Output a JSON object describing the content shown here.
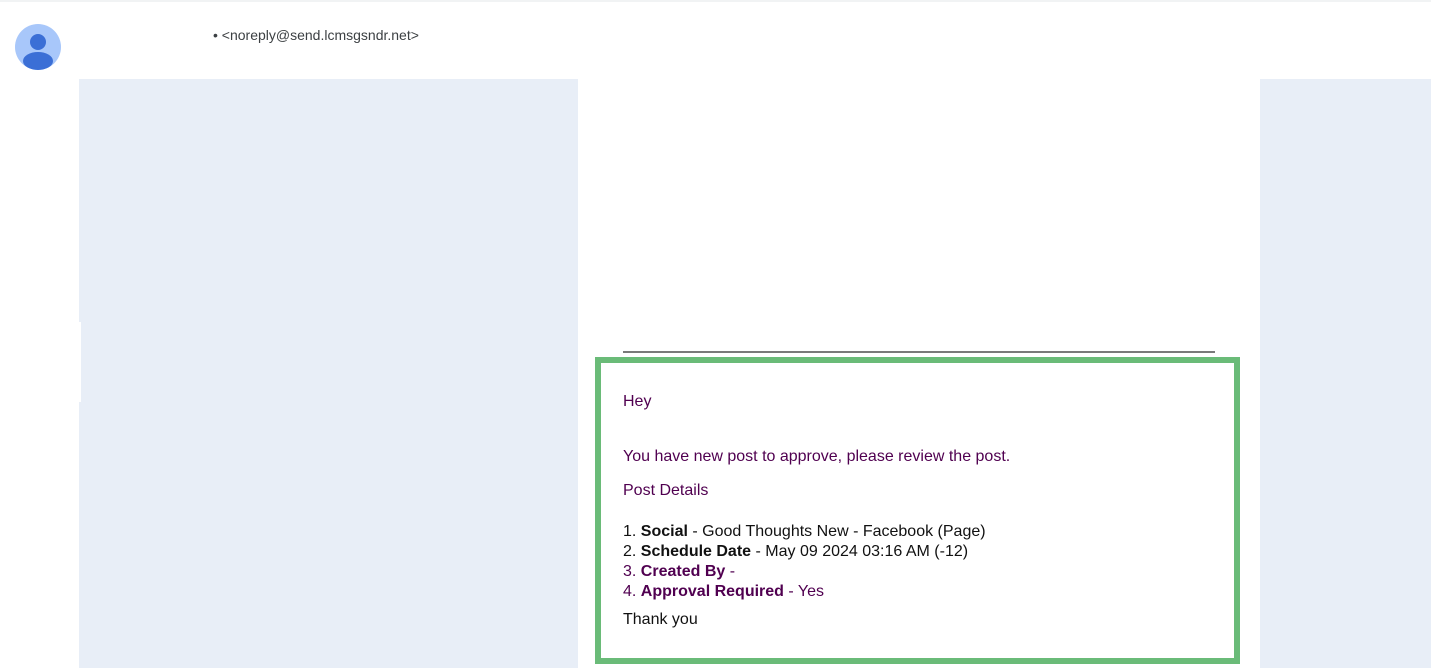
{
  "header": {
    "sender_email": "• <noreply@send.lcmsgsndr.net>"
  },
  "message": {
    "greeting": "Hey",
    "intro": "You have new post to approve, please review the post.",
    "details_heading": "Post Details",
    "details": [
      {
        "num": "1.",
        "label": "Social",
        "value": " - Good Thoughts New - Facebook (Page)"
      },
      {
        "num": "2.",
        "label": "Schedule Date",
        "value": " - May 09 2024 03:16 AM (-12)"
      },
      {
        "num": "3.",
        "label": "Created By",
        "value": " -"
      },
      {
        "num": "4.",
        "label": "Approval Required",
        "value": " - Yes"
      }
    ],
    "closing": "Thank you"
  },
  "colors": {
    "highlight_border": "#6abb78",
    "side_panel": "#e8eef7",
    "link_purple": "#500050"
  },
  "icons": {
    "avatar": "default-person-avatar-icon"
  }
}
